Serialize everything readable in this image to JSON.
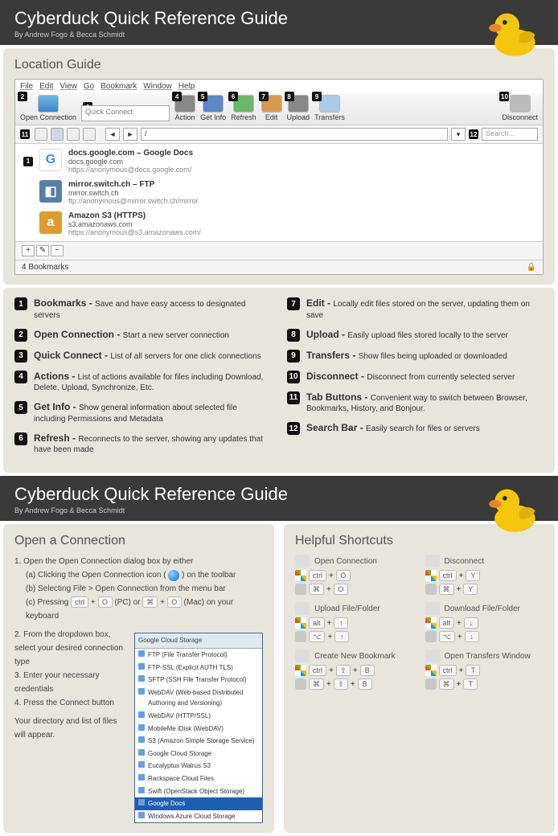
{
  "header": {
    "title": "Cyberduck Quick Reference Guide",
    "byline": "By Andrew Fogo & Becca Schmidt"
  },
  "location_guide": {
    "heading": "Location Guide",
    "menu": [
      "File",
      "Edit",
      "View",
      "Go",
      "Bookmark",
      "Window",
      "Help"
    ],
    "toolbar": {
      "open_connection": "Open Connection",
      "quick_connect": "Quick Connect",
      "action": "Action",
      "get_info": "Get Info",
      "refresh": "Refresh",
      "edit": "Edit",
      "upload": "Upload",
      "transfers": "Transfers",
      "disconnect": "Disconnect"
    },
    "path": "/",
    "search_placeholder": "Search...",
    "bookmarks": [
      {
        "title": "docs.google.com – Google Docs",
        "sub": "docs.google.com",
        "url": "https://anonymous@docs.google.com/",
        "icon_bg": "#fff",
        "icon_text": "G",
        "icon_color": "#4285f4"
      },
      {
        "title": "mirror.switch.ch – FTP",
        "sub": "mirror.switch.ch",
        "url": "ftp://anonymous@mirror.switch.ch/mirror",
        "icon_bg": "#5a7fa6",
        "icon_text": "◧",
        "icon_color": "#fff"
      },
      {
        "title": "Amazon S3 (HTTPS)",
        "sub": "s3.amazonaws.com",
        "url": "https://anonymous@s3.amazonaws.com/",
        "icon_bg": "#e09b2d",
        "icon_text": "a",
        "icon_color": "#fff"
      }
    ],
    "status": "4 Bookmarks"
  },
  "legend": [
    {
      "n": "1",
      "t": "Bookmarks",
      "d": "Save and have easy access to designated servers"
    },
    {
      "n": "2",
      "t": "Open Connection",
      "d": "Start a new server connection"
    },
    {
      "n": "3",
      "t": "Quick Connect",
      "d": "List of all servers for one click connections"
    },
    {
      "n": "4",
      "t": "Actions",
      "d": "List of actions available for files including Download, Delete, Upload, Synchronize, Etc."
    },
    {
      "n": "5",
      "t": "Get Info",
      "d": "Show general information about selected file including Permissions and Metadata"
    },
    {
      "n": "6",
      "t": "Refresh",
      "d": "Reconnects to the server, showing any updates that have been made"
    },
    {
      "n": "7",
      "t": "Edit",
      "d": "Locally edit files stored on the server, updating them on save"
    },
    {
      "n": "8",
      "t": "Upload",
      "d": "Easily upload files stored locally to the server"
    },
    {
      "n": "9",
      "t": "Transfers",
      "d": "Show files being uploaded or downloaded"
    },
    {
      "n": "10",
      "t": "Disconnect",
      "d": "Disconnect from currently selected server"
    },
    {
      "n": "11",
      "t": "Tab Buttons",
      "d": "Convenient way to switch between Browser, Bookmarks, History, and Bonjour."
    },
    {
      "n": "12",
      "t": "Search Bar",
      "d": "Easily search for files or servers"
    }
  ],
  "open_conn": {
    "heading": "Open a Connection",
    "s1": "Open the Open Connection dialog box by either",
    "s1a": "(a) Clicking the Open Connection icon (",
    "s1a2": ") on the toolbar",
    "s1b": "(b) Selecting File > Open Connection from the menu bar",
    "s1c": "(c) Pressing",
    "s1c_pc": "(PC) or",
    "s1c_mac": "(Mac) on your keyboard",
    "s2": "From the dropdown box, select your desired connection type",
    "s3": "Enter your necessary credentials",
    "s4": "Press the Connect button",
    "s5": "Your directory and list of files will appear.",
    "dd_head": "Google Cloud Storage",
    "dd_items": [
      "FTP (File Transfer Protocol)",
      "FTP-SSL (Explicit AUTH TLS)",
      "SFTP (SSH File Transfer Protocol)",
      "WebDAV (Web-based Distributed Authoring and Versioning)",
      "WebDAV (HTTP/SSL)",
      "MobileMe iDisk (WebDAV)",
      "S3 (Amazon Simple Storage Service)",
      "Google Cloud Storage",
      "Eucalyptus Walrus S3",
      "Rackspace Cloud Files",
      "Swift (OpenStack Object Storage)",
      "Google Docs",
      "Windows Azure Cloud Storage"
    ]
  },
  "shortcuts": {
    "heading": "Helpful Shortcuts",
    "items": [
      {
        "name": "Open Connection",
        "win": [
          "ctrl",
          "O"
        ],
        "mac": [
          "⌘",
          "O"
        ]
      },
      {
        "name": "Disconnect",
        "win": [
          "ctrl",
          "Y"
        ],
        "mac": [
          "⌘",
          "Y"
        ]
      },
      {
        "name": "Upload File/Folder",
        "win": [
          "alt",
          "↑"
        ],
        "mac": [
          "⌥",
          "↑"
        ]
      },
      {
        "name": "Download File/Folder",
        "win": [
          "alt",
          "↓"
        ],
        "mac": [
          "⌥",
          "↓"
        ]
      },
      {
        "name": "Create New Bookmark",
        "win": [
          "ctrl",
          "⇧",
          "B"
        ],
        "mac": [
          "⌘",
          "⇧",
          "B"
        ]
      },
      {
        "name": "Open Transfers Window",
        "win": [
          "ctrl",
          "T"
        ],
        "mac": [
          "⌘",
          "T"
        ]
      }
    ]
  },
  "keys": {
    "ctrl": "ctrl",
    "plus": "+",
    "O": "O",
    "cmd": "⌘"
  }
}
